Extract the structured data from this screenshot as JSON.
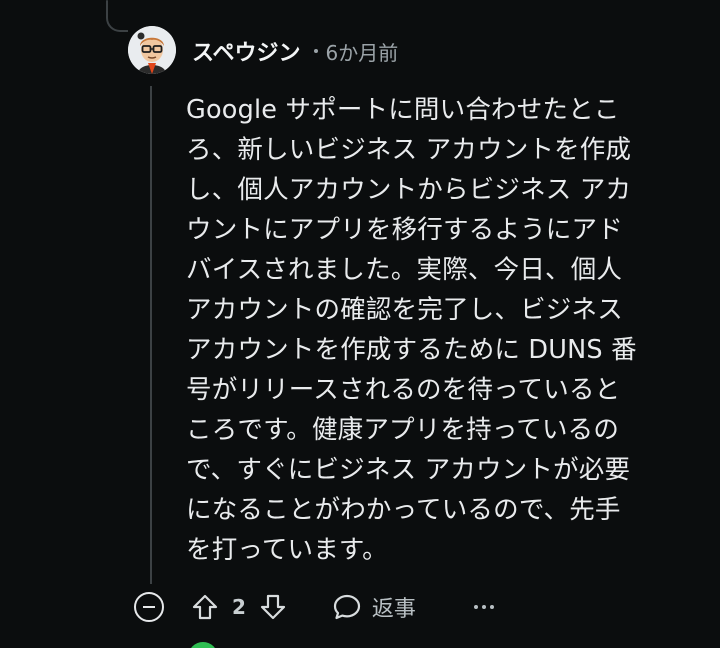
{
  "comment": {
    "author": "スペウジン",
    "timestamp": "6か月前",
    "body_lines": [
      "Google サポートに問い合わせたとこ",
      "ろ、新しいビジネス アカウントを作成",
      "し、個人アカウントからビジネス アカ",
      "ウントにアプリを移行するようにアド",
      "バイスされました。実際、今日、個人",
      "アカウントの確認を完了し、ビジネス",
      "アカウントを作成するために DUNS 番",
      "号がリリースされるのを待っていると",
      "ころです。健康アプリを持っているの",
      "で、すぐにビジネス アカウントが必要",
      "になることがわかっているので、先手",
      "を打っています。"
    ]
  },
  "actions": {
    "score": "2",
    "reply_label": "返事"
  },
  "icons": {
    "avatar": "avatar-icon",
    "collapse": "collapse-icon",
    "upvote": "upvote-icon",
    "downvote": "downvote-icon",
    "reply": "comment-bubble-icon",
    "more": "more-options-icon"
  },
  "colors": {
    "background": "#0b0d0e",
    "text": "#e9ebed",
    "muted": "#9ba3a8",
    "thread_line": "#3c4144"
  }
}
